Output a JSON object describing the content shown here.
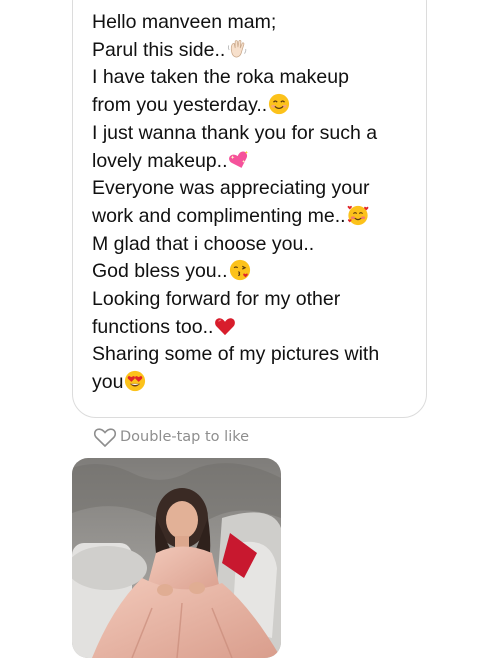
{
  "message": {
    "lines": [
      {
        "text": "Hello manveen mam;",
        "emoji": null
      },
      {
        "text": "Parul this side..",
        "emoji": "waving-hand-icon"
      },
      {
        "text": "I have taken the roka makeup",
        "emoji": null
      },
      {
        "text": "from you yesterday..",
        "emoji": "smiling-face-icon"
      },
      {
        "text": "I just wanna thank you for such a",
        "emoji": null
      },
      {
        "text": "lovely makeup..",
        "emoji": "sparkling-heart-icon"
      },
      {
        "text": "Everyone was appreciating your",
        "emoji": null
      },
      {
        "text": "work and complimenting me..",
        "emoji": "smiling-face-with-hearts-icon"
      },
      {
        "text": "M glad that i choose you..",
        "emoji": null
      },
      {
        "text": "God bless you..",
        "emoji": "face-blowing-kiss-icon"
      },
      {
        "text": "Looking forward for my other",
        "emoji": null
      },
      {
        "text": "functions too..",
        "emoji": "red-heart-icon"
      },
      {
        "text": "Sharing some of my pictures with",
        "emoji": null
      },
      {
        "text": "you",
        "emoji": "heart-eyes-icon"
      }
    ]
  },
  "like_hint": {
    "label": "Double-tap to like",
    "icon": "heart-outline-icon"
  },
  "photo": {
    "kind": "shared-photo",
    "colors": {
      "dress": "#e9b7a6",
      "wall": "#9c9a96",
      "chair": "#d9d8d6",
      "pillow": "#c8182f"
    }
  },
  "colors": {
    "text": "#111111",
    "muted": "#8e8e8e",
    "bubble_border": "#dcdcdc"
  }
}
